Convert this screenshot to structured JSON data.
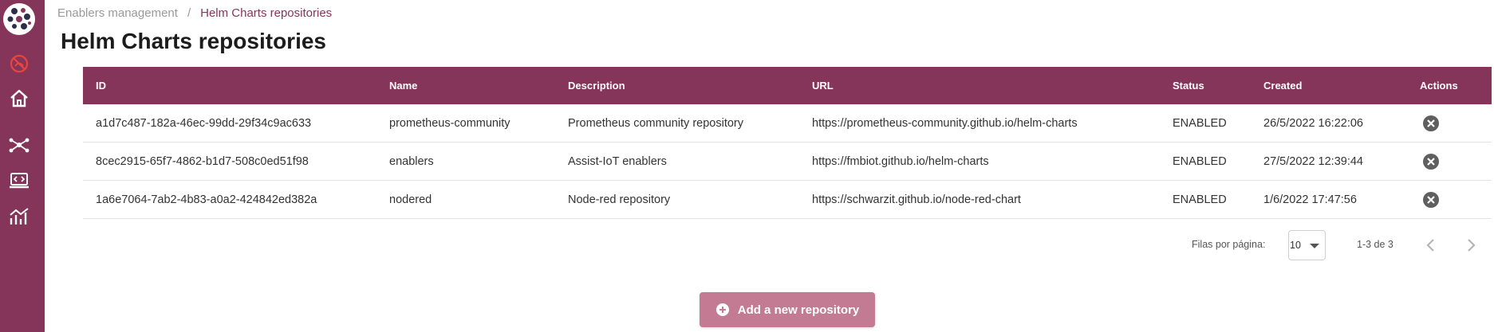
{
  "breadcrumb": {
    "root": "Enablers management",
    "separator": "/",
    "current": "Helm Charts repositories"
  },
  "page": {
    "title": "Helm Charts repositories"
  },
  "colors": {
    "brand": "#86355a",
    "button": "#c27b92"
  },
  "sidebar": {
    "items": [
      {
        "icon": "disabled-network-icon"
      },
      {
        "icon": "home-icon"
      },
      {
        "icon": "network-topology-icon"
      },
      {
        "icon": "code-laptop-icon"
      },
      {
        "icon": "analytics-chart-icon"
      }
    ]
  },
  "table": {
    "headers": {
      "id": "ID",
      "name": "Name",
      "description": "Description",
      "url": "URL",
      "status": "Status",
      "created": "Created",
      "actions": "Actions"
    },
    "rows": [
      {
        "id": "a1d7c487-182a-46ec-99dd-29f34c9ac633",
        "name": "prometheus-community",
        "description": "Prometheus community repository",
        "url": "https://prometheus-community.github.io/helm-charts",
        "status": "ENABLED",
        "created": "26/5/2022 16:22:06"
      },
      {
        "id": "8cec2915-65f7-4862-b1d7-508c0ed51f98",
        "name": "enablers",
        "description": "Assist-IoT enablers",
        "url": "https://fmbiot.github.io/helm-charts",
        "status": "ENABLED",
        "created": "27/5/2022 12:39:44"
      },
      {
        "id": "1a6e7064-7ab2-4b83-a0a2-424842ed382a",
        "name": "nodered",
        "description": "Node-red repository",
        "url": "https://schwarzit.github.io/node-red-chart",
        "status": "ENABLED",
        "created": "1/6/2022 17:47:56"
      }
    ]
  },
  "pagination": {
    "rows_label": "Filas por página:",
    "rows_value": "10",
    "range": "1-3 de 3"
  },
  "actions": {
    "add_label": "Add a new repository"
  }
}
